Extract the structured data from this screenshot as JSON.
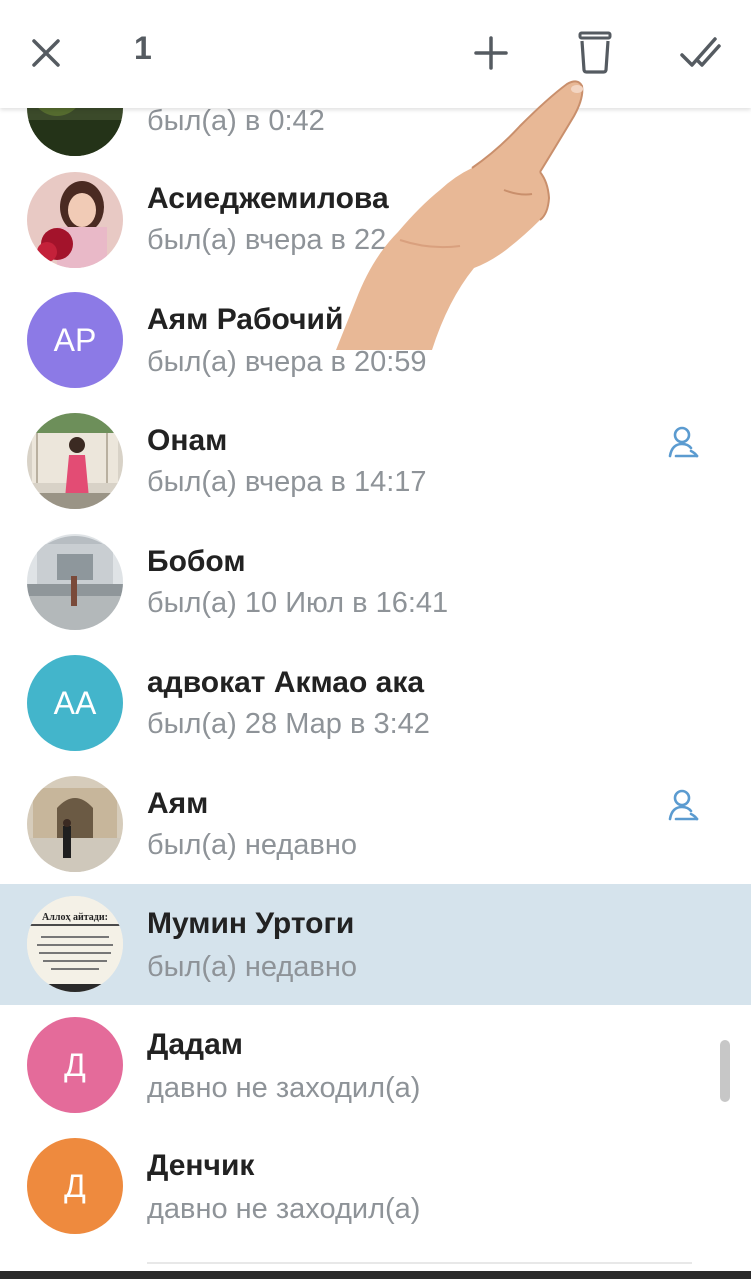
{
  "toolbar": {
    "close_icon": "close-icon",
    "selected_count": "1",
    "add_icon": "plus-icon",
    "delete_icon": "trash-icon",
    "check_icon": "double-check-icon"
  },
  "contacts": [
    {
      "name": "",
      "status": "был(а) в 0:42",
      "avatar_type": "photo"
    },
    {
      "name": "Асиеджемилова",
      "status": "был(а) вчера в 22",
      "avatar_type": "photo"
    },
    {
      "name": "Аям Рабочий",
      "status": "был(а) вчера в 20:59",
      "avatar_type": "initials",
      "initials": "AP",
      "avatar_color": "#8c7ae6"
    },
    {
      "name": "Онам",
      "status": "был(а) вчера в 14:17",
      "avatar_type": "photo",
      "has_contact_icon": true
    },
    {
      "name": "Бобом",
      "status": "был(а) 10 Июл в 16:41",
      "avatar_type": "photo"
    },
    {
      "name": "адвокат Акмао ака",
      "status": "был(а) 28 Мар в 3:42",
      "avatar_type": "initials",
      "initials": "AA",
      "avatar_color": "#43b5cb"
    },
    {
      "name": "Аям",
      "status": "был(а) недавно",
      "avatar_type": "photo",
      "has_contact_icon": true
    },
    {
      "name": "Мумин Уртоги",
      "status": "был(а) недавно",
      "avatar_type": "photo",
      "selected": true,
      "avatar_text": "Аллоҳ айтади:"
    },
    {
      "name": "Дадам",
      "status": "давно не заходил(а)",
      "avatar_type": "initials",
      "initials": "Д",
      "avatar_color": "#e46b9a"
    },
    {
      "name": "Денчик",
      "status": "давно не заходил(а)",
      "avatar_type": "initials",
      "initials": "Д",
      "avatar_color": "#ee8a3e"
    }
  ],
  "colors": {
    "selection": "#d5e3ec",
    "accent_icon": "#5b9bd0",
    "status_text": "#8e9398"
  }
}
